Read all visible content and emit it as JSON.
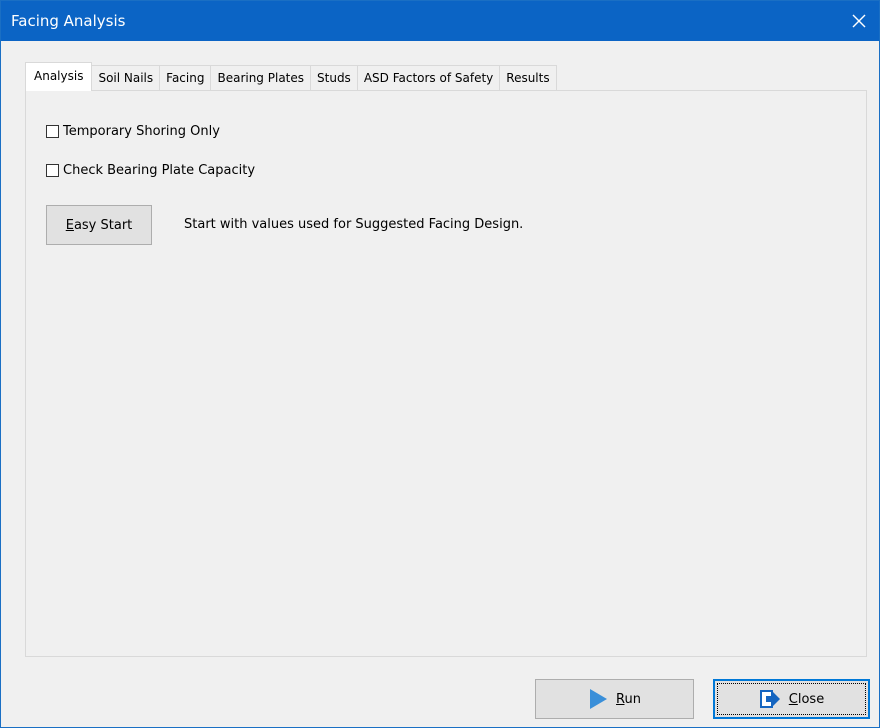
{
  "window": {
    "title": "Facing Analysis",
    "title_bar_color": "#0b64c5"
  },
  "tabs": [
    {
      "label": "Analysis",
      "active": true
    },
    {
      "label": "Soil Nails",
      "active": false
    },
    {
      "label": "Facing",
      "active": false
    },
    {
      "label": "Bearing Plates",
      "active": false
    },
    {
      "label": "Studs",
      "active": false
    },
    {
      "label": "ASD Factors of Safety",
      "active": false
    },
    {
      "label": "Results",
      "active": false
    }
  ],
  "analysis": {
    "temporary_shoring_label": "Temporary Shoring Only",
    "temporary_shoring_checked": false,
    "check_bearing_label": "Check Bearing Plate Capacity",
    "check_bearing_checked": false,
    "easy_start_mnemonic": "E",
    "easy_start_rest": "asy Start",
    "easy_start_description": "Start with values used for Suggested Facing Design."
  },
  "footer": {
    "run_mnemonic": "R",
    "run_rest": "un",
    "run_icon": "play-icon",
    "run_icon_color": "#3a8fd9",
    "close_mnemonic": "C",
    "close_rest": "lose",
    "close_icon": "exit-icon",
    "close_icon_color": "#1565c0"
  }
}
